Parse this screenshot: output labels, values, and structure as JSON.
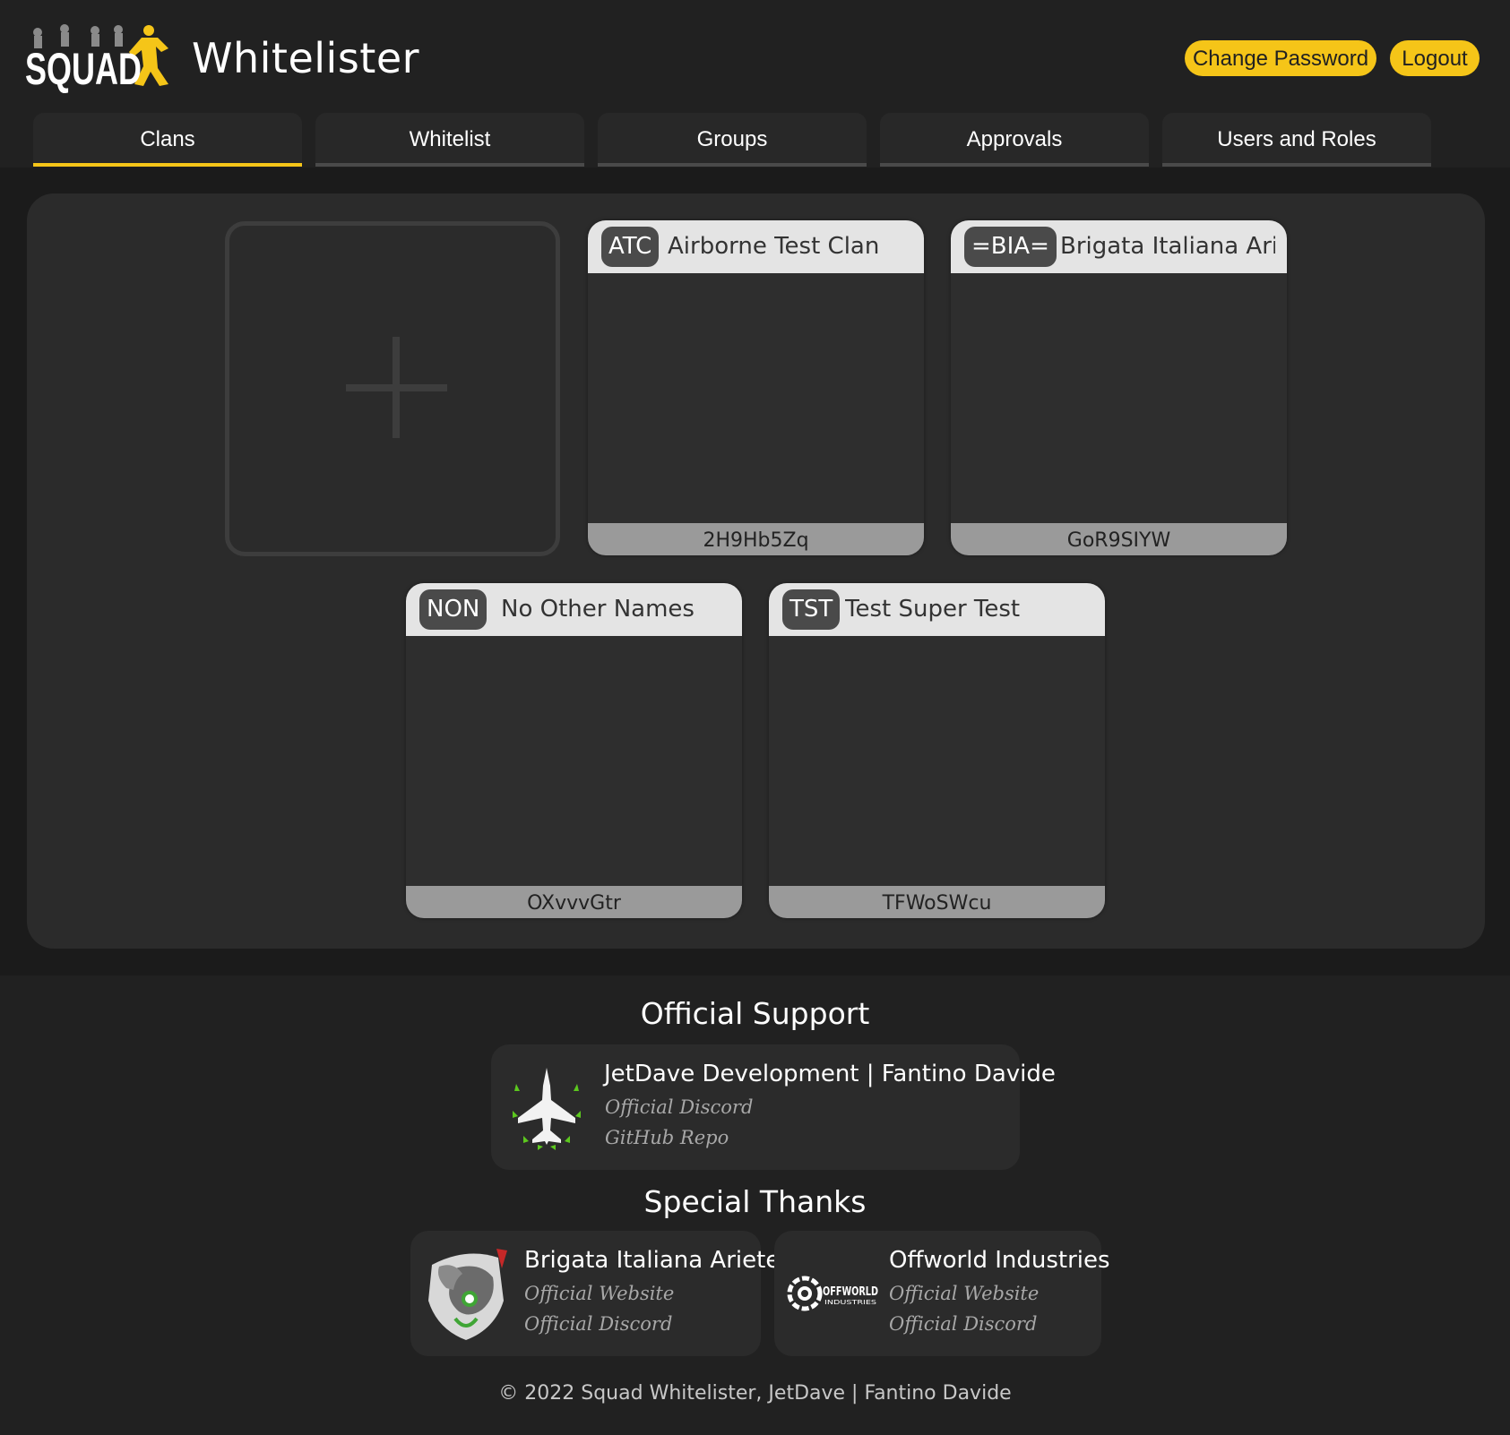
{
  "header": {
    "logo_text": "SQUAD",
    "app_title": "Whitelister",
    "change_password_label": "Change Password",
    "logout_label": "Logout",
    "accent_color": "#f5c518"
  },
  "tabs": [
    {
      "label": "Clans",
      "active": true
    },
    {
      "label": "Whitelist",
      "active": false
    },
    {
      "label": "Groups",
      "active": false
    },
    {
      "label": "Approvals",
      "active": false
    },
    {
      "label": "Users and Roles",
      "active": false
    }
  ],
  "clans": {
    "add_icon": "plus-icon",
    "items": [
      {
        "tag": "ATC",
        "name": "Airborne Test Clan",
        "code": "2H9Hb5Zq"
      },
      {
        "tag": "=BIA=",
        "name": "Brigata Italiana Ariete",
        "code": "GoR9SIYW"
      },
      {
        "tag": "NON",
        "name": "No Other Names",
        "code": "OXvvvGtr"
      },
      {
        "tag": "TST",
        "name": "Test Super Test",
        "code": "TFWoSWcu"
      }
    ]
  },
  "footer": {
    "official_support_title": "Official Support",
    "support": {
      "name": "JetDave Development | Fantino Davide",
      "link1": "Official Discord",
      "link2": "GitHub Repo",
      "icon": "jet-logo-icon"
    },
    "special_thanks_title": "Special Thanks",
    "thanks": [
      {
        "name": "Brigata Italiana Ariete",
        "link1": "Official Website",
        "link2": "Official Discord",
        "icon": "ram-logo-icon"
      },
      {
        "name": "Offworld Industries",
        "link1": "Official Website",
        "link2": "Official Discord",
        "icon": "offworld-logo-icon",
        "logo_text": "OFFWORLD",
        "logo_subtext": "INDUSTRIES"
      }
    ],
    "copyright": "© 2022 Squad Whitelister, JetDave | Fantino Davide"
  }
}
